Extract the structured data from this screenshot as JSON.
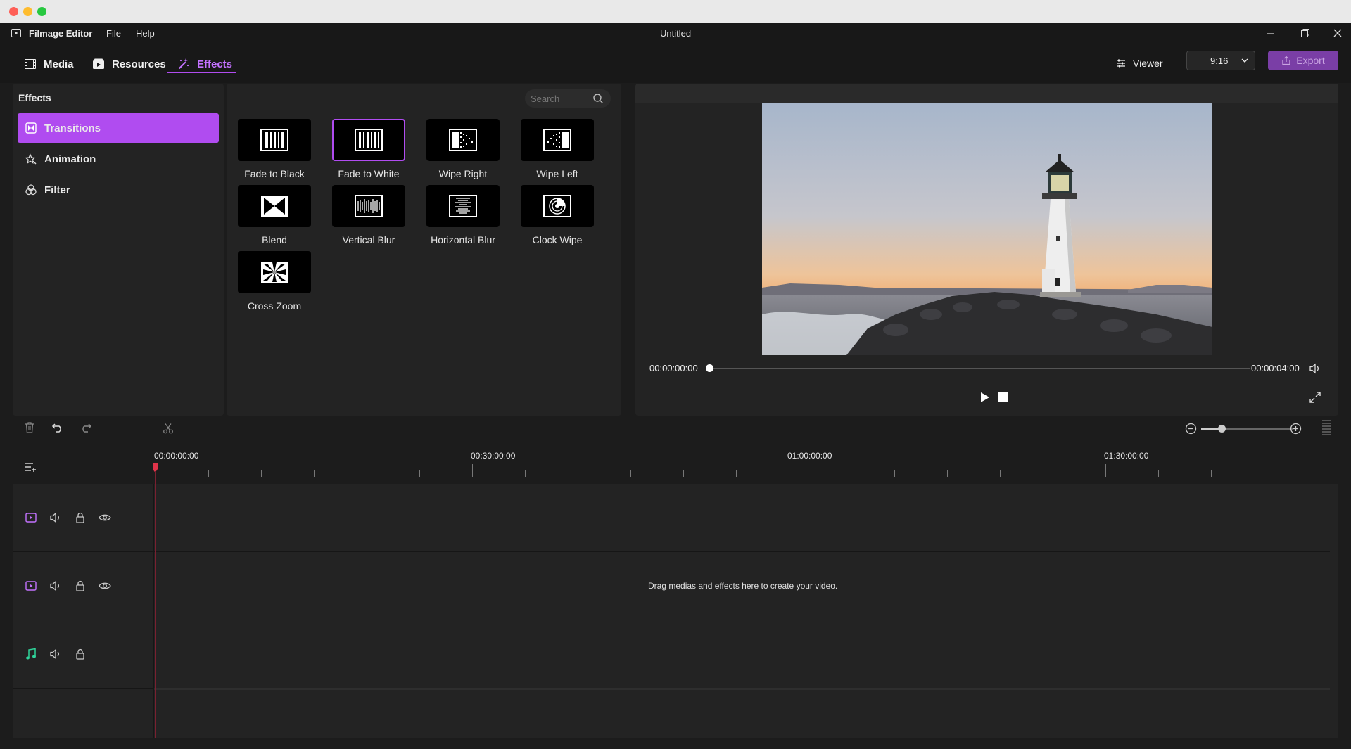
{
  "window": {
    "app_name": "Filmage Editor",
    "menu": [
      "File",
      "Help"
    ],
    "document_title": "Untitled"
  },
  "nav": {
    "tabs": [
      {
        "label": "Media",
        "icon": "film-icon"
      },
      {
        "label": "Resources",
        "icon": "resources-icon"
      },
      {
        "label": "Effects",
        "icon": "magic-wand-icon",
        "active": true
      }
    ],
    "viewer_label": "Viewer",
    "ratio_value": "9:16",
    "export_label": "Export"
  },
  "effects_panel": {
    "title": "Effects",
    "items": [
      {
        "label": "Transitions",
        "icon": "transitions-icon",
        "active": true
      },
      {
        "label": "Animation",
        "icon": "animation-icon"
      },
      {
        "label": "Filter",
        "icon": "filter-icon"
      }
    ]
  },
  "library": {
    "search_placeholder": "Search",
    "tiles": [
      {
        "label": "Fade to Black",
        "icon": "fade-to-black-icon"
      },
      {
        "label": "Fade to White",
        "icon": "fade-to-white-icon",
        "selected": true
      },
      {
        "label": "Wipe Right",
        "icon": "wipe-right-icon"
      },
      {
        "label": "Wipe Left",
        "icon": "wipe-left-icon"
      },
      {
        "label": "Blend",
        "icon": "blend-icon"
      },
      {
        "label": "Vertical Blur",
        "icon": "vertical-blur-icon"
      },
      {
        "label": "Horizontal Blur",
        "icon": "horizontal-blur-icon"
      },
      {
        "label": "Clock Wipe",
        "icon": "clock-wipe-icon"
      },
      {
        "label": "Cross Zoom",
        "icon": "cross-zoom-icon"
      }
    ]
  },
  "viewer": {
    "current_time": "00:00:00:00",
    "total_time": "00:00:04:00",
    "progress": 0
  },
  "timeline": {
    "ruler_labels": [
      "00:00:00:00",
      "00:30:00:00",
      "01:00:00:00",
      "01:30:00:00"
    ],
    "empty_hint": "Drag medias and effects here to create your video.",
    "zoom_level": 0.2
  },
  "colors": {
    "accent": "#b04cf0",
    "audio_track": "#2fd49a"
  }
}
